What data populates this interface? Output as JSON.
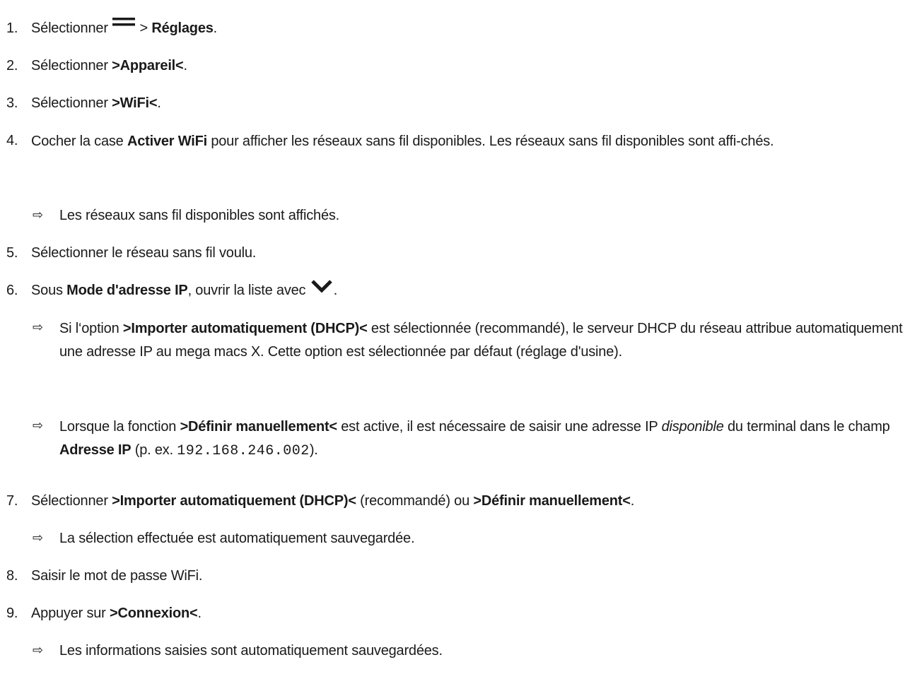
{
  "steps": {
    "s1": {
      "num": "1.",
      "pre": "Sélectionner ",
      "mid": " > ",
      "bold": "Réglages",
      "post": "."
    },
    "s2": {
      "num": "2.",
      "pre": "Sélectionner ",
      "bold": ">Appareil<",
      "post": "."
    },
    "s3": {
      "num": "3.",
      "pre": "Sélectionner ",
      "bold": ">WiFi<",
      "post": "."
    },
    "s4": {
      "num": "4.",
      "pre": "Cocher la case ",
      "bold": "Activer WiFi",
      "post": " pour afficher les réseaux sans fil disponibles. Les réseaux sans fil disponibles sont affi-chés."
    },
    "s4r": {
      "text": "Les réseaux sans fil disponibles sont affichés."
    },
    "s5": {
      "num": "5.",
      "text": "Sélectionner le réseau sans fil voulu."
    },
    "s6": {
      "num": "6.",
      "pre": "Sous ",
      "bold": "Mode d'adresse IP",
      "mid": ", ouvrir la liste avec ",
      "post": "."
    },
    "s6a": {
      "pre": "Si l‘option ",
      "bold": ">Importer automatiquement (DHCP)<",
      "post": " est sélectionnée (recommandé), le serveur DHCP du réseau attribue automatiquement une adresse IP au mega macs X. Cette option est sélectionnée par défaut (réglage d'usine)."
    },
    "s6b": {
      "pre": "Lorsque la fonction ",
      "bold": ">Définir manuellement<",
      "mid": " est active, il est nécessaire de saisir une adresse IP ",
      "italic": "disponible",
      "mid2": " du terminal dans le champ ",
      "bold2": "Adresse IP",
      "mid3": " (p. ex. ",
      "code": "192.168.246.002",
      "post": ")."
    },
    "s7": {
      "num": "7.",
      "pre": "Sélectionner ",
      "bold": ">Importer automatiquement (DHCP)<",
      "mid": " (recommandé) ou ",
      "bold2": ">Définir manuellement<",
      "post": "."
    },
    "s7r": {
      "text": "La sélection effectuée est automatiquement sauvegardée."
    },
    "s8": {
      "num": "8.",
      "text": "Saisir le mot de passe WiFi."
    },
    "s9": {
      "num": "9.",
      "pre": "Appuyer sur ",
      "bold": ">Connexion<",
      "post": "."
    },
    "s9r": {
      "text": "Les informations saisies sont automatiquement sauvegardées."
    }
  },
  "icons": {
    "menu": "hamburger-menu-icon",
    "dropdown": "chevron-down-icon",
    "result": "result-arrow-icon"
  },
  "result_arrow": "⇨"
}
